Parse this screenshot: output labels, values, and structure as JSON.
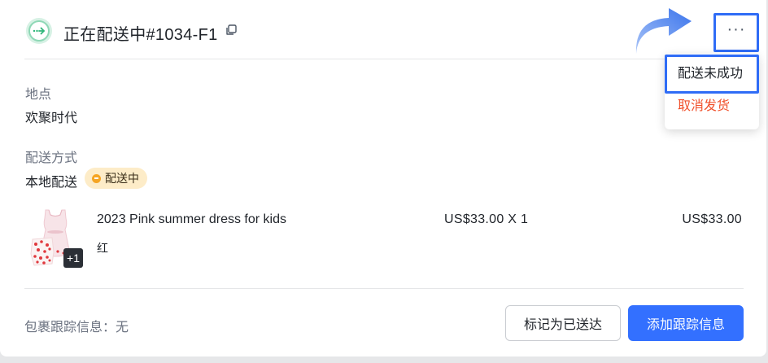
{
  "header": {
    "order_title": "正在配送中#1034-F1",
    "status_icon": "arrow-right-dashed-icon",
    "copy_icon": "copy-icon"
  },
  "location": {
    "label": "地点",
    "value": "欢聚时代"
  },
  "delivery": {
    "label": "配送方式",
    "method": "本地配送",
    "status_badge": "配送中"
  },
  "product": {
    "name": "2023 Pink summer dress for kids",
    "variant": "红",
    "unit_price_qty": "US$33.00 X 1",
    "total": "US$33.00",
    "extra_count": "+1"
  },
  "footer": {
    "tracking_label": "包裹跟踪信息：",
    "tracking_value": "无",
    "mark_delivered_label": "标记为已送达",
    "add_tracking_label": "添加跟踪信息"
  },
  "more_menu": {
    "trigger_label": "···",
    "items": [
      {
        "label": "配送未成功"
      },
      {
        "label": "取消发货"
      }
    ]
  },
  "colors": {
    "primary": "#3370ff",
    "highlight": "#2f6cf6",
    "danger": "#f0502b",
    "badge_bg": "#fdecc8",
    "badge_dot": "#f5a524",
    "status_green": "#2fb67a"
  }
}
